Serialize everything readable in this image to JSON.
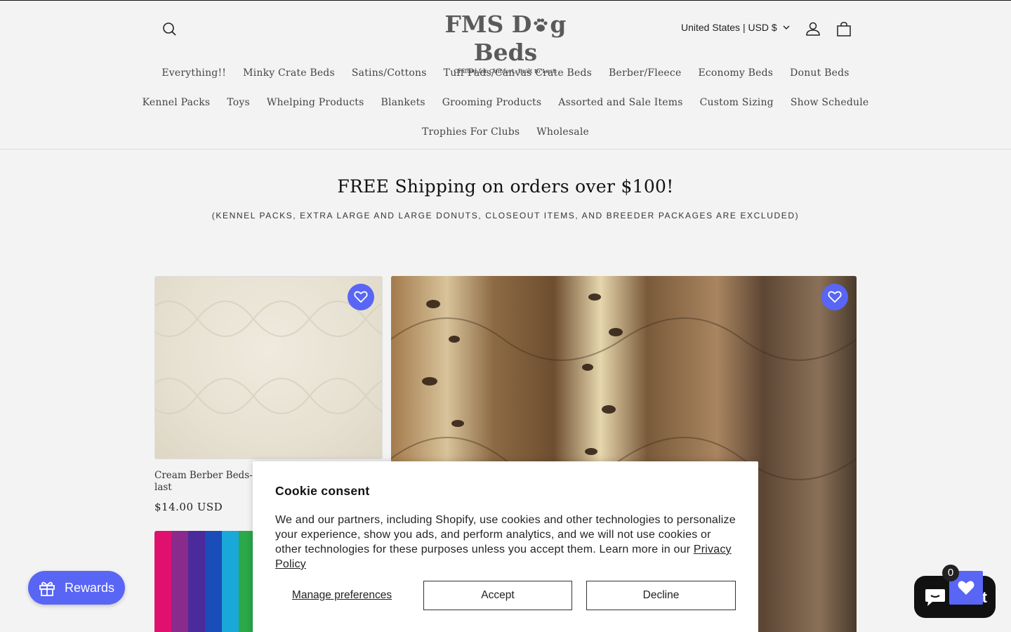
{
  "header": {
    "logo_title_pre": "FMS D",
    "logo_title_post": "g Beds",
    "logo_tagline": "Crafted for Comfort, Built to Last.",
    "locale": "United States | USD $",
    "icons": {
      "search": "search-icon",
      "account": "account-icon",
      "cart": "cart-icon",
      "locale_chevron": "chevron-down-icon"
    }
  },
  "nav": {
    "row1": [
      "Everything!!",
      "Minky Crate Beds",
      "Satins/Cottons",
      "Tuff Pads/Canvas Crate Beds",
      "Berber/Fleece",
      "Economy Beds",
      "Donut Beds"
    ],
    "row2": [
      "Kennel Packs",
      "Toys",
      "Whelping Products",
      "Blankets",
      "Grooming Products",
      "Assorted and Sale Items",
      "Custom Sizing",
      "Show Schedule"
    ],
    "row3": [
      "Trophies For Clubs",
      "Wholesale"
    ]
  },
  "promo": {
    "heading": "FREE Shipping on orders over $100!",
    "subheading": "(Kennel Packs, Extra large and Large Donuts, Closeout items, and Breeder Packages are Excluded)"
  },
  "products": [
    {
      "title": "Cream Berber Beds- n… last",
      "price": "$14.00 USD"
    }
  ],
  "cookie": {
    "title": "Cookie consent",
    "body": "We and our partners, including Shopify, use cookies and other technologies to personalize your experience, show you ads, and perform analytics, and we will not use cookies or other technologies for these purposes unless you accept them. Learn more in our",
    "privacy_link": "Privacy Policy",
    "manage": "Manage preferences",
    "accept": "Accept",
    "decline": "Decline"
  },
  "rewards": {
    "label": "Rewards",
    "icon": "gift-icon"
  },
  "chat": {
    "label": "t"
  },
  "wishlist": {
    "count": "0",
    "icon": "heart-icon"
  },
  "colors": {
    "accent": "#5965f5",
    "background": "#f3f3f3",
    "chat": "#111111"
  }
}
